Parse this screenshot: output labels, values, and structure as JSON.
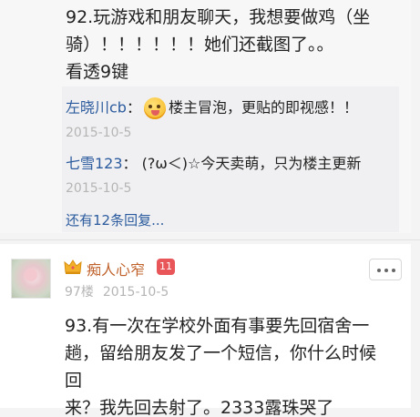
{
  "post92": {
    "line1": "92.玩游戏和朋友聊天，我想要做鸡（坐",
    "line2": "骑）！！！！！！她们还截图了。。",
    "line3": "看透9键"
  },
  "replies": [
    {
      "user": "左晓川cb",
      "colon": "：",
      "emoji": "grinning-face-emoji",
      "text": "楼主冒泡，更贴的即视感！！",
      "date": "2015-10-5"
    },
    {
      "user": "七雪123",
      "colon": "：",
      "text": " (?ω＜)☆今天卖萌，只为楼主更新",
      "date": "2015-10-5"
    }
  ],
  "more_replies": "还有12条回复...",
  "post93": {
    "author": "痴人心窄",
    "level": "11",
    "floor": "97楼",
    "date": "2015-10-5",
    "line1": "93.有一次在学校外面有事要先回宿舍一",
    "line2": "趟，留给朋友发了一个短信，你什么时候回",
    "line3": "来？我先回去射了。2333露珠哭了"
  },
  "colors": {
    "link": "#2b5b9e",
    "author": "#c0612b",
    "badge": "#e9565a",
    "meta": "#b5b5b5"
  }
}
